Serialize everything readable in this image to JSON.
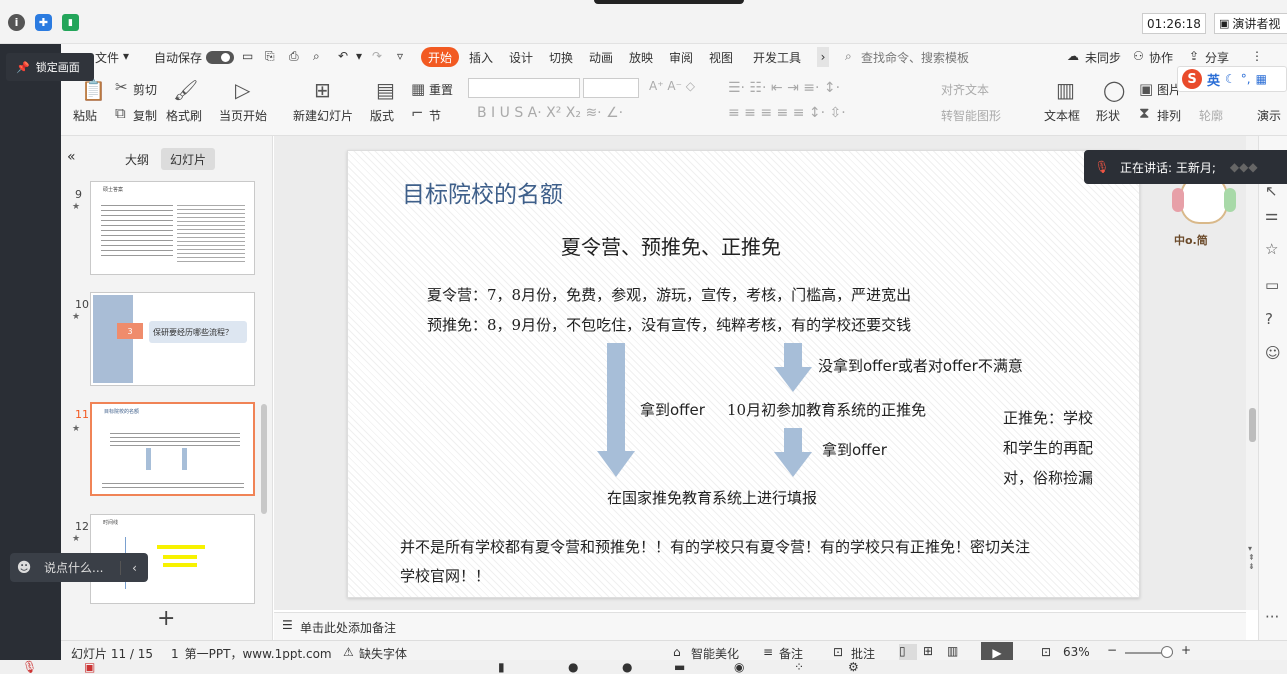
{
  "topbar": {
    "timer": "01:26:18",
    "presenter_view": "演讲者视"
  },
  "meeting": {
    "lock_label": "锁定画面",
    "chat_placeholder": "说点什么...",
    "speaking": "正在讲话: 王新月;"
  },
  "menu": {
    "file": "文件",
    "autosave": "自动保存",
    "tabs": [
      "开始",
      "插入",
      "设计",
      "切换",
      "动画",
      "放映",
      "审阅",
      "视图",
      "开发工具"
    ],
    "search": "查找命令、搜索模板",
    "unsynced": "未同步",
    "collab": "协作",
    "share": "分享"
  },
  "ribbon": {
    "paste": "粘贴",
    "cut": "剪切",
    "copy": "复制",
    "format_painter": "格式刷",
    "from_current": "当页开始",
    "new_slide": "新建幻灯片",
    "layout": "版式",
    "section": "节",
    "reset": "重置",
    "align_text": "对齐文本",
    "smartart": "转智能图形",
    "textbox": "文本框",
    "shape": "形状",
    "arrange": "排列",
    "outline": "轮廓",
    "picture": "图片",
    "present": "演示",
    "ime": "英"
  },
  "sidebar": {
    "tab_outline": "大纲",
    "tab_slides": "幻灯片",
    "slides": [
      {
        "num": "9",
        "title": "硕士答案"
      },
      {
        "num": "10",
        "badge": "3",
        "title": "保研要经历哪些流程？"
      },
      {
        "num": "11",
        "title": "目标院校的名额"
      },
      {
        "num": "12",
        "title": "时间线"
      }
    ],
    "add": "+"
  },
  "slide": {
    "title": "目标院校的名额",
    "subtitle": "夏令营、预推免、正推免",
    "line1": "夏令营：7，8月份，免费，参观，游玩，宣传，考核，门槛高，严进宽出",
    "line2": "预推免：8，9月份，不包吃住，没有宣传，纯粹考核，有的学校还要交钱",
    "no_offer": "没拿到offer或者对offer不满意",
    "get_offer_left": "拿到offer",
    "october": "10月初参加教育系统的正推免",
    "get_offer_right": "拿到offer",
    "fill_in": "在国家推免教育系统上进行填报",
    "zhengtuimian_1": "正推免：学校",
    "zhengtuimian_2": "和学生的再配",
    "zhengtuimian_3": "对，俗称捡漏",
    "footer_1": "并不是所有学校都有夏令营和预推免！！有的学校只有夏令营！有的学校只有正推免！密切关注",
    "footer_2": "学校官网！！"
  },
  "notes": {
    "placeholder": "单击此处添加备注"
  },
  "status": {
    "slide_pos": "幻灯片 11 / 15",
    "theme": "1_第一PPT，www.1ppt.com",
    "missing_font": "缺失字体",
    "beautify": "智能美化",
    "notes": "备注",
    "comments": "批注",
    "zoom": "63%"
  },
  "colors": {
    "accent": "#f25a22",
    "arrow": "#a7bed8",
    "title": "#3e5f8a"
  }
}
